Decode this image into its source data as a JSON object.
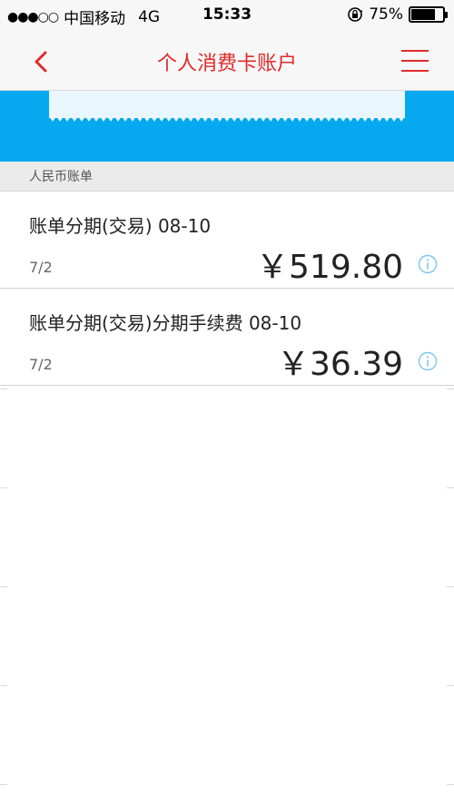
{
  "status_bar": {
    "signal": "●●●○○",
    "carrier": "中国移动",
    "network": "4G",
    "time": "15:33",
    "battery_percent": "75%",
    "battery_level": 0.75
  },
  "nav": {
    "title": "个人消费卡账户"
  },
  "section": {
    "title": "人民币账单"
  },
  "transactions": [
    {
      "title": "账单分期(交易) 08-10",
      "installment": "7/2",
      "amount": "￥519.80"
    },
    {
      "title": "账单分期(交易)分期手续费 08-10",
      "installment": "7/2",
      "amount": "￥36.39"
    }
  ],
  "colors": {
    "accent_red": "#e02b2b",
    "header_blue": "#06a9ef",
    "info_blue": "#7cc6ef"
  }
}
